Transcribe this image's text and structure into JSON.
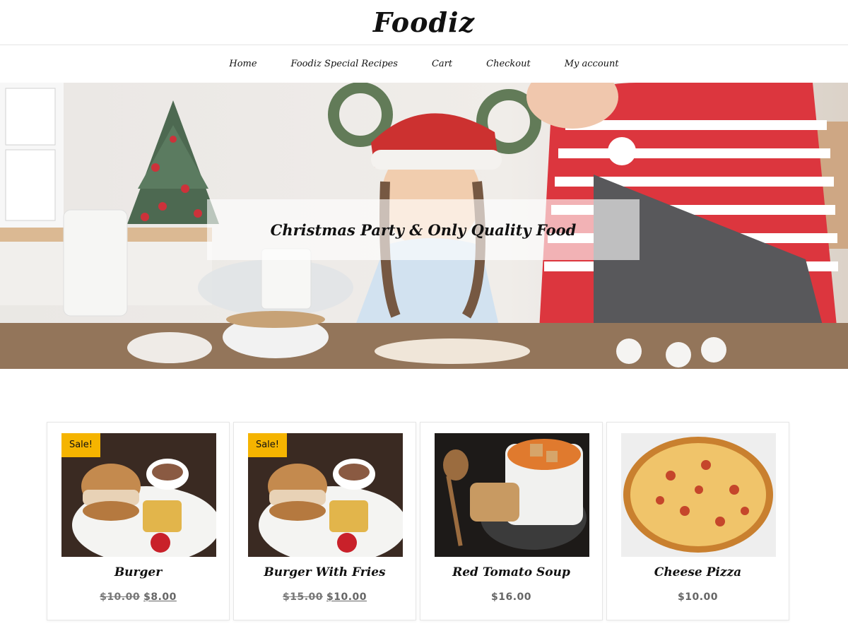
{
  "header": {
    "site_title": "Foodiz"
  },
  "nav": {
    "items": [
      {
        "label": "Home"
      },
      {
        "label": "Foodiz Special Recipes"
      },
      {
        "label": "Cart"
      },
      {
        "label": "Checkout"
      },
      {
        "label": "My account"
      }
    ]
  },
  "hero": {
    "caption": "Christmas Party & Only Quality Food"
  },
  "products": [
    {
      "name": "Burger",
      "sale_badge": "Sale!",
      "regular_price": "$10.00",
      "sale_price": "$8.00"
    },
    {
      "name": "Burger With Fries",
      "sale_badge": "Sale!",
      "regular_price": "$15.00",
      "sale_price": "$10.00"
    },
    {
      "name": "Red Tomato Soup",
      "price": "$16.00"
    },
    {
      "name": "Cheese Pizza",
      "price": "$10.00"
    }
  ],
  "colors": {
    "sale_badge": "#f5b400",
    "text": "#111111",
    "price": "#666666"
  }
}
